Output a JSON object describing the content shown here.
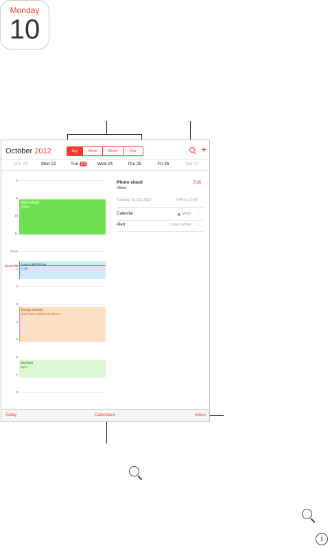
{
  "app_icon": {
    "day": "Monday",
    "date": "10"
  },
  "header": {
    "month": "October",
    "year": "2012"
  },
  "view_switcher": [
    "Day",
    "Week",
    "Month",
    "Year"
  ],
  "week": [
    {
      "label": "Sun 21",
      "dim": true
    },
    {
      "label": "Mon 22",
      "dim": false
    },
    {
      "label": "Tue",
      "badge": "23",
      "dim": false
    },
    {
      "label": "Wed 24",
      "dim": false
    },
    {
      "label": "Thu 25",
      "dim": false
    },
    {
      "label": "Fri 26",
      "dim": false
    },
    {
      "label": "Sat 27",
      "dim": true
    }
  ],
  "hours": [
    "8",
    "9",
    "10",
    "11",
    "Noon",
    "1",
    "2",
    "3",
    "4",
    "5",
    "6",
    "7",
    "8"
  ],
  "now_label": "12:45 PM",
  "events": [
    {
      "title": "Photo Shoot",
      "sub": "Offsite",
      "color": "#6ee04f",
      "text": "#ffffff"
    },
    {
      "title": "Lunch with Brian",
      "sub": "Cafe",
      "color": "#cfe9fb",
      "text": "#2a6fa8"
    },
    {
      "title": "Design Review",
      "sub": "2nd Floor Conference Room",
      "color": "#fde0c3",
      "text": "#b45d14"
    },
    {
      "title": "Workout",
      "sub": "Gym",
      "color": "#dcf8d2",
      "text": "#2f8a2f"
    }
  ],
  "details": {
    "title": "Photo shoot",
    "subtitle": "Offsite",
    "edit": "Edit",
    "date": "Tuesday, Oct 23, 2012",
    "time": "9 AM to 11 AM",
    "calendar_label": "Calendar",
    "calendar_value": "Work",
    "alert_label": "Alert",
    "alert_value": "1 hour before"
  },
  "bottom_bar": {
    "today": "Today",
    "calendars": "Calendars",
    "inbox": "Inbox"
  },
  "colors": {
    "accent": "#f23b2f"
  }
}
